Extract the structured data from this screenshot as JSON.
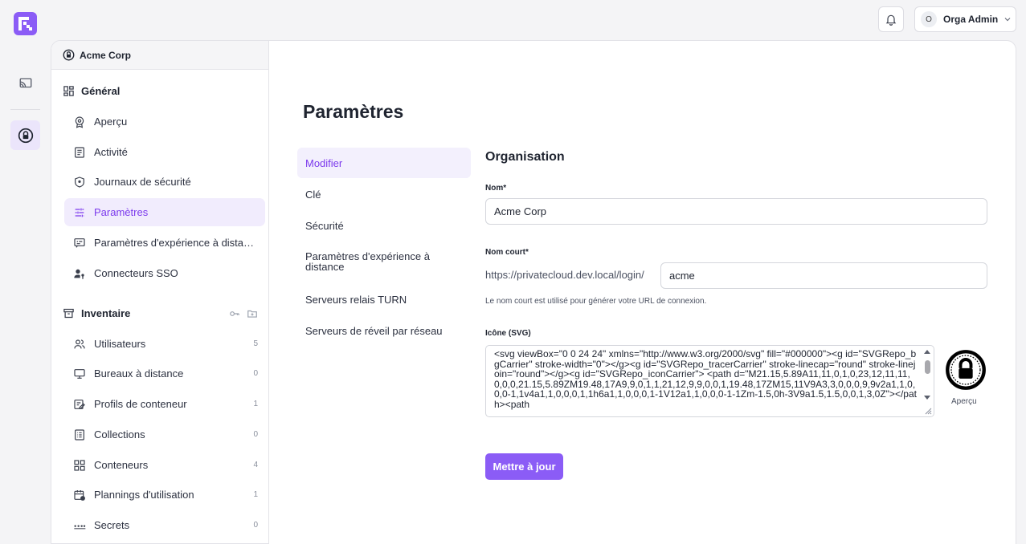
{
  "header": {
    "user_initial": "O",
    "user_name": "Orga Admin"
  },
  "sidebar": {
    "org_name": "Acme Corp",
    "general": {
      "title": "Général",
      "items": [
        {
          "label": "Aperçu",
          "icon": "badge-icon"
        },
        {
          "label": "Activité",
          "icon": "document-icon"
        },
        {
          "label": "Journaux de sécurité",
          "icon": "shield-icon"
        },
        {
          "label": "Paramètres",
          "icon": "sliders-icon",
          "active": true
        },
        {
          "label": "Paramètres d'expérience à distance",
          "icon": "message-icon"
        },
        {
          "label": "Connecteurs SSO",
          "icon": "user-key-icon"
        }
      ]
    },
    "inventory": {
      "title": "Inventaire",
      "items": [
        {
          "label": "Utilisateurs",
          "count": "5",
          "icon": "users-icon"
        },
        {
          "label": "Bureaux à distance",
          "count": "0",
          "icon": "monitor-icon"
        },
        {
          "label": "Profils de conteneur",
          "count": "1",
          "icon": "profile-icon"
        },
        {
          "label": "Collections",
          "count": "0",
          "icon": "list-icon"
        },
        {
          "label": "Conteneurs",
          "count": "4",
          "icon": "grid-icon"
        },
        {
          "label": "Plannings d'utilisation",
          "count": "1",
          "icon": "calendar-icon"
        },
        {
          "label": "Secrets",
          "count": "0",
          "icon": "dots-icon"
        }
      ]
    }
  },
  "main": {
    "title": "Paramètres",
    "subnav": [
      {
        "label": "Modifier",
        "active": true
      },
      {
        "label": "Clé"
      },
      {
        "label": "Sécurité"
      },
      {
        "label": "Paramètres d'expérience à distance"
      },
      {
        "label": "Serveurs relais TURN"
      },
      {
        "label": "Serveurs de réveil par réseau"
      }
    ],
    "form": {
      "section_title": "Organisation",
      "name_label": "Nom*",
      "name_value": "Acme Corp",
      "short_label": "Nom court*",
      "short_prefix": "https://privatecloud.dev.local/login/",
      "short_value": "acme",
      "short_help": "Le nom court est utilisé pour générer votre URL de connexion.",
      "icon_label": "Icône (SVG)",
      "icon_value": "<svg viewBox=\"0 0 24 24\" xmlns=\"http://www.w3.org/2000/svg\" fill=\"#000000\"><g id=\"SVGRepo_bgCarrier\" stroke-width=\"0\"></g><g id=\"SVGRepo_tracerCarrier\" stroke-linecap=\"round\" stroke-linejoin=\"round\"></g><g id=\"SVGRepo_iconCarrier\"> <path d=\"M21.15,5.89A11,11,0,1,0,23,12,11,11,0,0,0,21.15,5.89ZM19.48,17A9,9,0,1,1,21,12,9,9,0,0,1,19.48,17ZM15,11V9A3,3,0,0,0,9,9v2a1,1,0,0,0-1,1v4a1,1,0,0,0,1,1h6a1,1,0,0,0,1-1V12a1,1,0,0,0-1-1Zm-1.5,0h-3V9a1.5,1.5,0,0,1,3,0Z\"></path><path",
      "preview_label": "Aperçu",
      "submit_label": "Mettre à jour"
    }
  }
}
